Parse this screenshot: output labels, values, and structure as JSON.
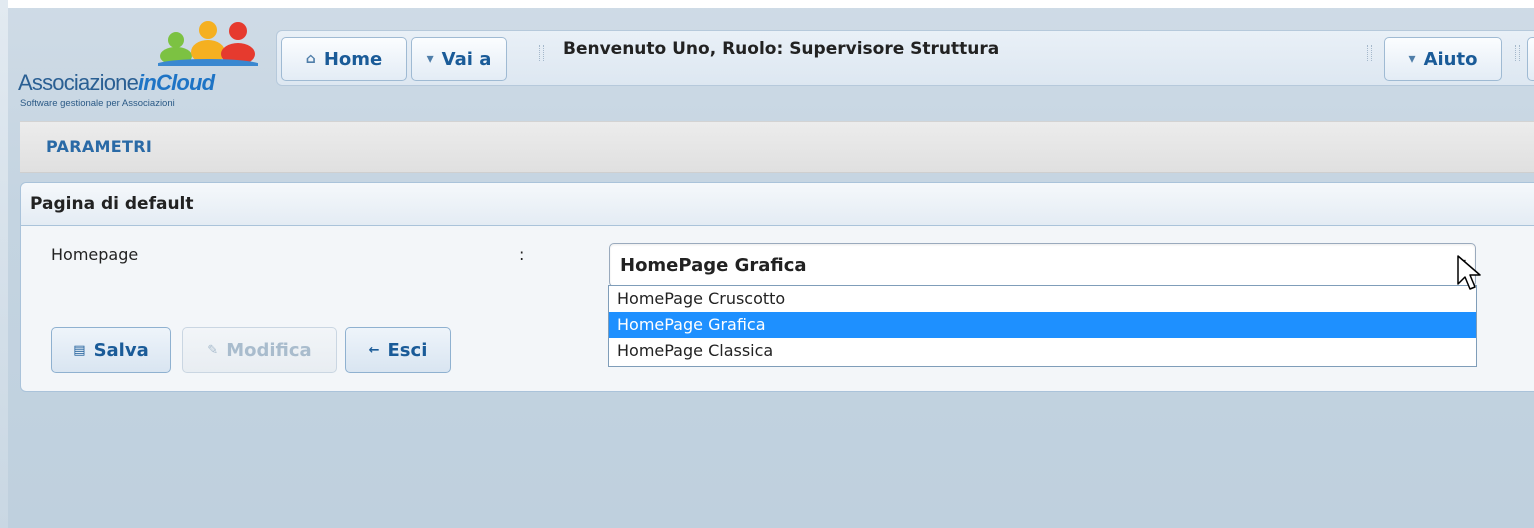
{
  "logo": {
    "name_part1": "Associazione",
    "name_part2": "inCloud",
    "tagline": "Software gestionale per Associazioni"
  },
  "toolbar": {
    "home_label": "Home",
    "home_icon": "home-icon",
    "goto_label": "Vai a",
    "goto_icon": "chevron-down-icon",
    "welcome_text": "Benvenuto Uno, Ruolo: Supervisore Struttura",
    "help_label": "Aiuto",
    "help_icon": "chevron-down-icon"
  },
  "page": {
    "section_title": "PARAMETRI"
  },
  "panel": {
    "title": "Pagina di default",
    "field_label": "Homepage",
    "colon": ":",
    "select_value": "HomePage Grafica",
    "options": [
      {
        "label": "HomePage Cruscotto",
        "selected": false
      },
      {
        "label": "HomePage Grafica",
        "selected": true
      },
      {
        "label": "HomePage Classica",
        "selected": false
      }
    ]
  },
  "actions": {
    "save_label": "Salva",
    "save_icon": "floppy-icon",
    "edit_label": "Modifica",
    "edit_icon": "pencil-icon",
    "exit_label": "Esci",
    "exit_icon": "arrow-left-icon"
  },
  "colors": {
    "accent": "#1a5b98",
    "selected_option": "#1e90ff",
    "background": "#c4d4e1"
  }
}
